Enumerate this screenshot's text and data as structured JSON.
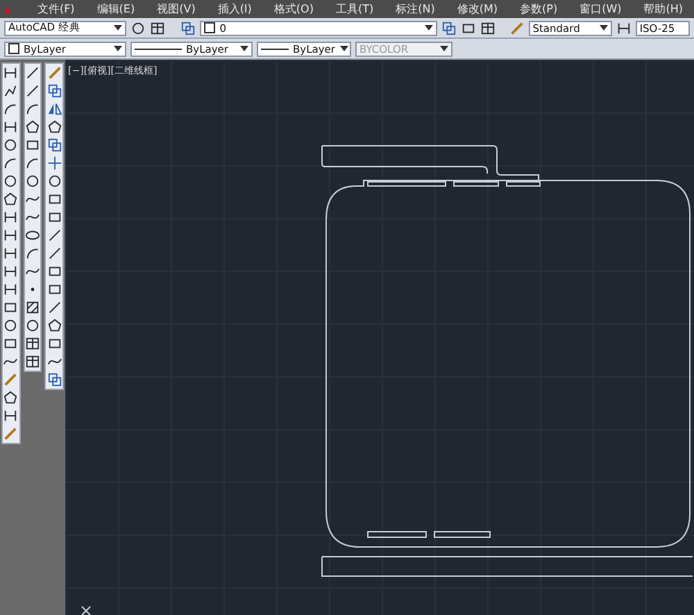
{
  "menu": [
    {
      "label": "文件(F)"
    },
    {
      "label": "编辑(E)"
    },
    {
      "label": "视图(V)"
    },
    {
      "label": "插入(I)"
    },
    {
      "label": "格式(O)"
    },
    {
      "label": "工具(T)"
    },
    {
      "label": "标注(N)"
    },
    {
      "label": "修改(M)"
    },
    {
      "label": "参数(P)"
    },
    {
      "label": "窗口(W)"
    },
    {
      "label": "帮助(H)"
    }
  ],
  "toolbar": {
    "workspace": "AutoCAD 经典",
    "layer": "0",
    "text_style": "Standard",
    "dim_style": "ISO-25"
  },
  "properties": {
    "color_setting": "ByLayer",
    "linetype": "ByLayer",
    "lineweight": "ByLayer",
    "plot_style": {
      "value": "BYCOLOR",
      "disabled": true
    }
  },
  "viewport": {
    "label": "[−][俯视][二维线框]"
  }
}
